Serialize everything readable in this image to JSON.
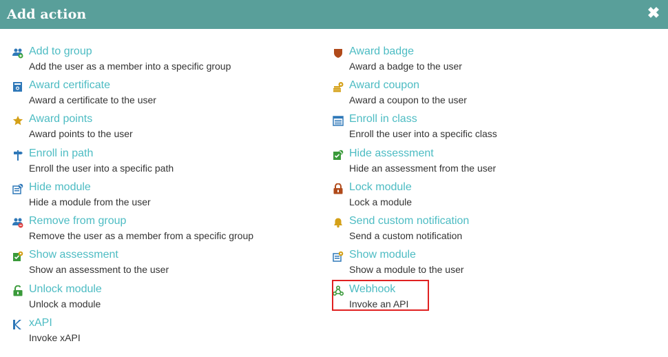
{
  "dialog": {
    "title": "Add action",
    "close_icon": "close-icon",
    "close_glyph": "✖"
  },
  "colors": {
    "header": "#599f9a",
    "link": "#4dbcc3",
    "desc": "#333333",
    "highlight": "#e02020"
  },
  "left_column": [
    {
      "name": "Add to group",
      "desc": "Add the user as a member into a specific group",
      "icon": "users-add-icon"
    },
    {
      "name": "Award certificate",
      "desc": "Award a certificate to the user",
      "icon": "certificate-icon"
    },
    {
      "name": "Award points",
      "desc": "Award points to the user",
      "icon": "star-icon"
    },
    {
      "name": "Enroll in path",
      "desc": "Enroll the user into a specific path",
      "icon": "signpost-icon"
    },
    {
      "name": "Hide module",
      "desc": "Hide a module from the user",
      "icon": "module-hide-icon"
    },
    {
      "name": "Remove from group",
      "desc": "Remove the user as a member from a specific group",
      "icon": "users-remove-icon"
    },
    {
      "name": "Show assessment",
      "desc": "Show an assessment to the user",
      "icon": "assessment-show-icon"
    },
    {
      "name": "Unlock module",
      "desc": "Unlock a module",
      "icon": "unlock-icon"
    },
    {
      "name": "xAPI",
      "desc": "Invoke xAPI",
      "icon": "xapi-icon"
    }
  ],
  "right_column": [
    {
      "name": "Award badge",
      "desc": "Award a badge to the user",
      "icon": "badge-icon"
    },
    {
      "name": "Award coupon",
      "desc": "Award a coupon to the user",
      "icon": "coupon-icon"
    },
    {
      "name": "Enroll in class",
      "desc": "Enroll the user into a specific class",
      "icon": "calendar-icon"
    },
    {
      "name": "Hide assessment",
      "desc": "Hide an assessment from the user",
      "icon": "assessment-hide-icon"
    },
    {
      "name": "Lock module",
      "desc": "Lock a module",
      "icon": "lock-icon"
    },
    {
      "name": "Send custom notification",
      "desc": "Send a custom notification",
      "icon": "bell-icon"
    },
    {
      "name": "Show module",
      "desc": "Show a module to the user",
      "icon": "module-show-icon"
    },
    {
      "name": "Webhook",
      "desc": "Invoke an API",
      "icon": "webhook-icon"
    }
  ]
}
